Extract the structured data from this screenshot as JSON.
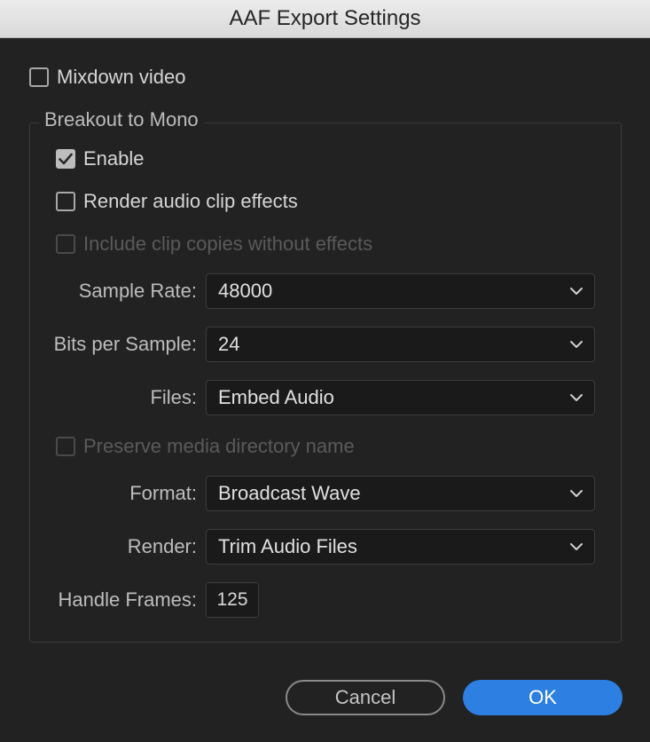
{
  "window": {
    "title": "AAF Export Settings"
  },
  "mixdown": {
    "label": "Mixdown video",
    "checked": false
  },
  "group": {
    "legend": "Breakout to Mono",
    "enable": {
      "label": "Enable",
      "checked": true
    },
    "render_effects": {
      "label": "Render audio clip effects",
      "checked": false
    },
    "include_copies": {
      "label": "Include clip copies without effects",
      "checked": false,
      "disabled": true
    },
    "sample_rate": {
      "label": "Sample Rate:",
      "value": "48000"
    },
    "bits_per_sample": {
      "label": "Bits per Sample:",
      "value": "24"
    },
    "files": {
      "label": "Files:",
      "value": "Embed Audio"
    },
    "preserve_dir": {
      "label": "Preserve media directory name",
      "checked": false,
      "disabled": true
    },
    "format": {
      "label": "Format:",
      "value": "Broadcast Wave"
    },
    "render": {
      "label": "Render:",
      "value": "Trim Audio Files"
    },
    "handle_frames": {
      "label": "Handle Frames:",
      "value": "125"
    }
  },
  "buttons": {
    "cancel": "Cancel",
    "ok": "OK"
  },
  "colors": {
    "accent": "#2d80e2",
    "background": "#222222"
  },
  "icons": {
    "checkmark": "checkmark-icon",
    "dropdown": "chevron-down-icon"
  }
}
